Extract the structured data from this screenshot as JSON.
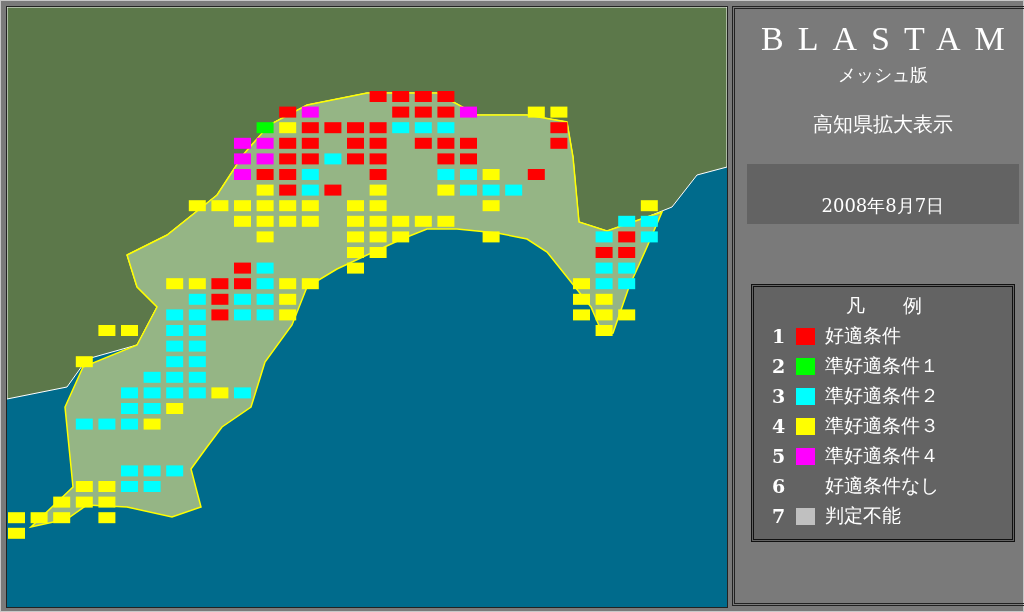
{
  "title": "BLASTAM",
  "subtitle": "メッシュ版",
  "region": "高知県拡大表示",
  "date": "2008年8月7日",
  "legend": {
    "heading": "凡　　例",
    "items": [
      {
        "number": "1",
        "label": "好適条件",
        "color": "#ff0000"
      },
      {
        "number": "2",
        "label": "準好適条件１",
        "color": "#00ff00"
      },
      {
        "number": "3",
        "label": "準好適条件２",
        "color": "#00ffff"
      },
      {
        "number": "4",
        "label": "準好適条件３",
        "color": "#ffff00"
      },
      {
        "number": "5",
        "label": "準好適条件４",
        "color": "#ff00ff"
      },
      {
        "number": "6",
        "label": "好適条件なし"
      },
      {
        "number": "7",
        "label": "判定不能",
        "color": "#c0c0c0"
      }
    ]
  },
  "mesh_rows": [
    [
      null,
      null,
      null,
      null,
      null,
      null,
      null,
      null,
      null,
      null,
      null,
      null,
      null,
      null,
      null,
      null,
      {
        "color": "#ff0000"
      },
      {
        "color": "#ff0000"
      },
      {
        "color": "#ff0000"
      },
      {
        "color": "#ff0000"
      }
    ],
    [
      null,
      null,
      null,
      null,
      null,
      null,
      null,
      null,
      null,
      null,
      null,
      null,
      {
        "color": "#ff0000"
      },
      {
        "color": "#ff00ff"
      },
      null,
      null,
      null,
      {
        "color": "#ff0000"
      },
      {
        "color": "#ff0000"
      },
      {
        "color": "#ff0000"
      },
      {
        "color": "#ff00ff"
      },
      null,
      null,
      {
        "color": "#ffff00"
      },
      {
        "color": "#ffff00"
      }
    ],
    [
      null,
      null,
      null,
      null,
      null,
      null,
      null,
      null,
      null,
      null,
      null,
      {
        "color": "#00ff00"
      },
      {
        "color": "#ffff00"
      },
      {
        "color": "#ff0000"
      },
      {
        "color": "#ff0000"
      },
      {
        "color": "#ff0000"
      },
      {
        "color": "#ff0000"
      },
      {
        "color": "#00ffff"
      },
      {
        "color": "#00ffff"
      },
      {
        "color": "#00ffff"
      },
      null,
      null,
      null,
      null,
      {
        "color": "#ff0000"
      }
    ],
    [
      null,
      null,
      null,
      null,
      null,
      null,
      null,
      null,
      null,
      null,
      {
        "color": "#ff00ff"
      },
      {
        "color": "#ff00ff"
      },
      {
        "color": "#ff0000"
      },
      {
        "color": "#ff0000"
      },
      null,
      {
        "color": "#ff0000"
      },
      {
        "color": "#ff0000"
      },
      null,
      {
        "color": "#ff0000"
      },
      {
        "color": "#ff0000"
      },
      {
        "color": "#ff0000"
      },
      null,
      null,
      null,
      {
        "color": "#ff0000"
      }
    ],
    [
      null,
      null,
      null,
      null,
      null,
      null,
      null,
      null,
      null,
      null,
      {
        "color": "#ff00ff"
      },
      {
        "color": "#ff00ff"
      },
      {
        "color": "#ff0000"
      },
      {
        "color": "#ff0000"
      },
      {
        "color": "#00ffff"
      },
      {
        "color": "#ff0000"
      },
      {
        "color": "#ff0000"
      },
      null,
      null,
      {
        "color": "#ff0000"
      },
      {
        "color": "#ff0000"
      }
    ],
    [
      null,
      null,
      null,
      null,
      null,
      null,
      null,
      null,
      null,
      null,
      {
        "color": "#ff00ff"
      },
      {
        "color": "#ff0000"
      },
      {
        "color": "#ff0000"
      },
      {
        "color": "#00ffff"
      },
      null,
      null,
      {
        "color": "#ff0000"
      },
      null,
      null,
      {
        "color": "#00ffff"
      },
      {
        "color": "#00ffff"
      },
      {
        "color": "#ffff00"
      },
      null,
      {
        "color": "#ff0000"
      }
    ],
    [
      null,
      null,
      null,
      null,
      null,
      null,
      null,
      null,
      null,
      null,
      null,
      {
        "color": "#ffff00"
      },
      {
        "color": "#ff0000"
      },
      {
        "color": "#00ffff"
      },
      {
        "color": "#ff0000"
      },
      null,
      {
        "color": "#ffff00"
      },
      null,
      null,
      {
        "color": "#ffff00"
      },
      {
        "color": "#00ffff"
      },
      {
        "color": "#00ffff"
      },
      {
        "color": "#00ffff"
      }
    ],
    [
      null,
      null,
      null,
      null,
      null,
      null,
      null,
      null,
      {
        "color": "#ffff00"
      },
      {
        "color": "#ffff00"
      },
      {
        "color": "#ffff00"
      },
      {
        "color": "#ffff00"
      },
      {
        "color": "#ffff00"
      },
      {
        "color": "#ffff00"
      },
      null,
      {
        "color": "#ffff00"
      },
      {
        "color": "#ffff00"
      },
      null,
      null,
      null,
      null,
      {
        "color": "#ffff00"
      },
      null,
      null,
      null,
      null,
      null,
      null,
      {
        "color": "#ffff00"
      }
    ],
    [
      null,
      null,
      null,
      null,
      null,
      null,
      null,
      null,
      null,
      null,
      {
        "color": "#ffff00"
      },
      {
        "color": "#ffff00"
      },
      {
        "color": "#ffff00"
      },
      {
        "color": "#ffff00"
      },
      null,
      {
        "color": "#ffff00"
      },
      {
        "color": "#ffff00"
      },
      {
        "color": "#ffff00"
      },
      {
        "color": "#ffff00"
      },
      {
        "color": "#ffff00"
      },
      null,
      null,
      null,
      null,
      null,
      null,
      null,
      {
        "color": "#00ffff"
      },
      {
        "color": "#00ffff"
      }
    ],
    [
      null,
      null,
      null,
      null,
      null,
      null,
      null,
      null,
      null,
      null,
      null,
      {
        "color": "#ffff00"
      },
      null,
      null,
      null,
      {
        "color": "#ffff00"
      },
      {
        "color": "#ffff00"
      },
      {
        "color": "#ffff00"
      },
      null,
      null,
      null,
      {
        "color": "#ffff00"
      },
      null,
      null,
      null,
      null,
      {
        "color": "#00ffff"
      },
      {
        "color": "#ff0000"
      },
      {
        "color": "#00ffff"
      }
    ],
    [
      null,
      null,
      null,
      null,
      null,
      null,
      null,
      null,
      null,
      null,
      null,
      null,
      null,
      null,
      null,
      {
        "color": "#ffff00"
      },
      {
        "color": "#ffff00"
      },
      null,
      null,
      null,
      null,
      null,
      null,
      null,
      null,
      null,
      {
        "color": "#ff0000"
      },
      {
        "color": "#ff0000"
      }
    ],
    [
      null,
      null,
      null,
      null,
      null,
      null,
      null,
      null,
      null,
      null,
      {
        "color": "#ff0000"
      },
      {
        "color": "#00ffff"
      },
      null,
      null,
      null,
      {
        "color": "#ffff00"
      },
      null,
      null,
      null,
      null,
      null,
      null,
      null,
      null,
      null,
      null,
      {
        "color": "#00ffff"
      },
      {
        "color": "#00ffff"
      }
    ],
    [
      null,
      null,
      null,
      null,
      null,
      null,
      null,
      {
        "color": "#ffff00"
      },
      {
        "color": "#ffff00"
      },
      {
        "color": "#ff0000"
      },
      {
        "color": "#ff0000"
      },
      {
        "color": "#00ffff"
      },
      {
        "color": "#ffff00"
      },
      {
        "color": "#ffff00"
      },
      null,
      null,
      null,
      null,
      null,
      null,
      null,
      null,
      null,
      null,
      null,
      {
        "color": "#ffff00"
      },
      {
        "color": "#00ffff"
      },
      {
        "color": "#00ffff"
      }
    ],
    [
      null,
      null,
      null,
      null,
      null,
      null,
      null,
      null,
      {
        "color": "#00ffff"
      },
      {
        "color": "#ff0000"
      },
      {
        "color": "#00ffff"
      },
      {
        "color": "#00ffff"
      },
      {
        "color": "#ffff00"
      },
      null,
      null,
      null,
      null,
      null,
      null,
      null,
      null,
      null,
      null,
      null,
      null,
      {
        "color": "#ffff00"
      },
      {
        "color": "#ffff00"
      }
    ],
    [
      null,
      null,
      null,
      null,
      null,
      null,
      null,
      {
        "color": "#00ffff"
      },
      {
        "color": "#00ffff"
      },
      {
        "color": "#ff0000"
      },
      {
        "color": "#00ffff"
      },
      {
        "color": "#00ffff"
      },
      {
        "color": "#ffff00"
      },
      null,
      null,
      null,
      null,
      null,
      null,
      null,
      null,
      null,
      null,
      null,
      null,
      {
        "color": "#ffff00"
      },
      {
        "color": "#ffff00"
      },
      {
        "color": "#ffff00"
      }
    ],
    [
      null,
      null,
      null,
      null,
      {
        "color": "#ffff00"
      },
      {
        "color": "#ffff00"
      },
      null,
      {
        "color": "#00ffff"
      },
      {
        "color": "#00ffff"
      },
      null,
      null,
      null,
      null,
      null,
      null,
      null,
      null,
      null,
      null,
      null,
      null,
      null,
      null,
      null,
      null,
      null,
      {
        "color": "#ffff00"
      }
    ],
    [
      null,
      null,
      null,
      null,
      null,
      null,
      null,
      {
        "color": "#00ffff"
      },
      {
        "color": "#00ffff"
      }
    ],
    [
      null,
      null,
      null,
      {
        "color": "#ffff00"
      },
      null,
      null,
      null,
      {
        "color": "#00ffff"
      },
      {
        "color": "#00ffff"
      }
    ],
    [
      null,
      null,
      null,
      null,
      null,
      null,
      {
        "color": "#00ffff"
      },
      {
        "color": "#00ffff"
      },
      {
        "color": "#00ffff"
      }
    ],
    [
      null,
      null,
      null,
      null,
      null,
      {
        "color": "#00ffff"
      },
      {
        "color": "#00ffff"
      },
      {
        "color": "#00ffff"
      },
      {
        "color": "#00ffff"
      },
      {
        "color": "#ffff00"
      },
      {
        "color": "#00ffff"
      }
    ],
    [
      null,
      null,
      null,
      null,
      null,
      {
        "color": "#00ffff"
      },
      {
        "color": "#00ffff"
      },
      {
        "color": "#ffff00"
      }
    ],
    [
      null,
      null,
      null,
      {
        "color": "#00ffff"
      },
      {
        "color": "#00ffff"
      },
      {
        "color": "#00ffff"
      },
      {
        "color": "#ffff00"
      }
    ],
    [
      null
    ],
    [
      null
    ],
    [
      null,
      null,
      null,
      null,
      null,
      {
        "color": "#00ffff"
      },
      {
        "color": "#00ffff"
      },
      {
        "color": "#00ffff"
      }
    ],
    [
      null,
      null,
      null,
      {
        "color": "#ffff00"
      },
      {
        "color": "#ffff00"
      },
      {
        "color": "#00ffff"
      },
      {
        "color": "#00ffff"
      }
    ],
    [
      null,
      null,
      {
        "color": "#ffff00"
      },
      {
        "color": "#ffff00"
      },
      {
        "color": "#ffff00"
      }
    ],
    [
      {
        "color": "#ffff00"
      },
      {
        "color": "#ffff00"
      },
      {
        "color": "#ffff00"
      },
      null,
      {
        "color": "#ffff00"
      }
    ],
    [
      {
        "color": "#ffff00"
      }
    ]
  ]
}
